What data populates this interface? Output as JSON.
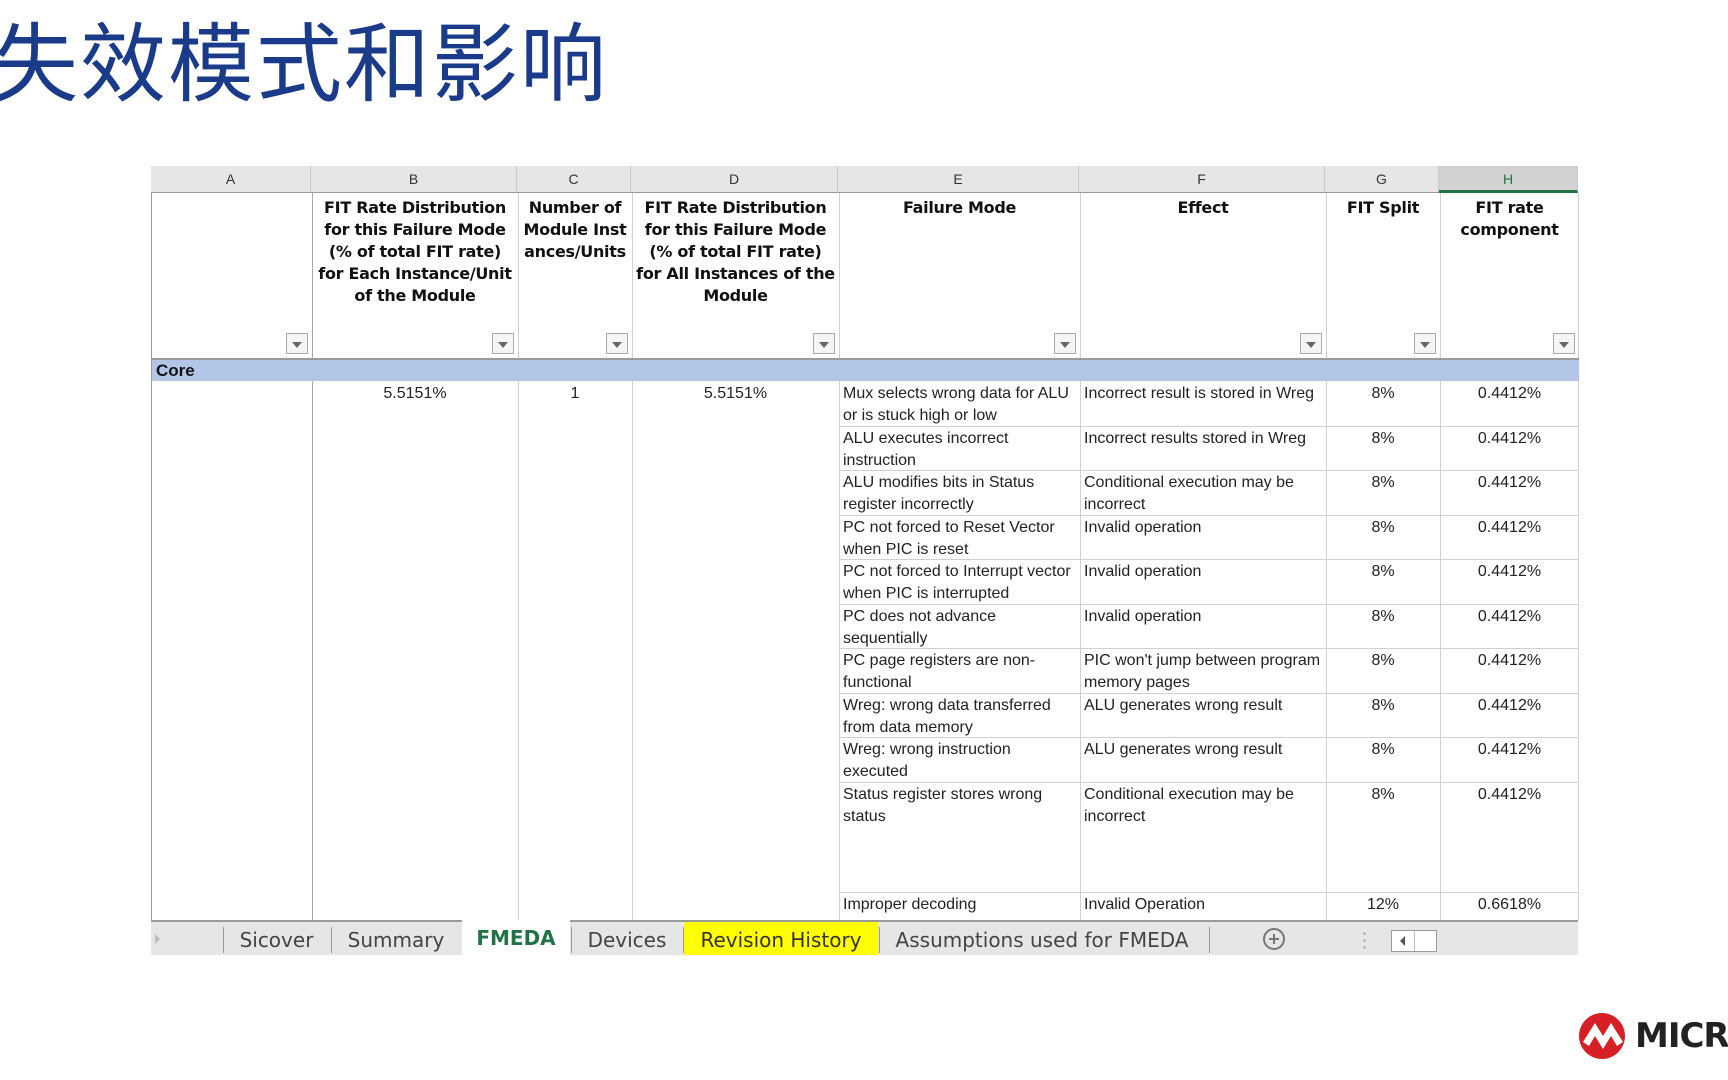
{
  "slide": {
    "title": "失效模式和影响",
    "logo_text": "MICRO",
    "brand_color": "#d71f26",
    "title_color": "#1a3a8a"
  },
  "sheet": {
    "column_letters": [
      "A",
      "B",
      "C",
      "D",
      "E",
      "F",
      "G",
      "H"
    ],
    "selected_column": "H",
    "headers": {
      "A": "",
      "B": "FIT Rate Distribution for this Failure Mode (% of total FIT rate) for Each Instance/Unit of the Module",
      "C": "Number of Module Instances/Units",
      "D": "FIT Rate Distribution for this Failure Mode (% of total FIT rate) for All Instances of the Module",
      "E": "Failure Mode",
      "F": "Effect",
      "G": "FIT Split",
      "H": "FIT rate component"
    },
    "group": {
      "label": "Core",
      "band_color": "#b4c6e7",
      "fit_each_instance": "5.5151%",
      "instances": "1",
      "fit_all_instances": "5.5151%"
    },
    "rows": [
      {
        "failure_mode": "Mux selects wrong data for ALU or is stuck high or low",
        "effect": "Incorrect result is stored in Wreg",
        "fit_split": "8%",
        "fit_component": "0.4412%"
      },
      {
        "failure_mode": "ALU executes incorrect instruction",
        "effect": "Incorrect results stored in Wreg",
        "fit_split": "8%",
        "fit_component": "0.4412%"
      },
      {
        "failure_mode": "ALU modifies bits in Status register incorrectly",
        "effect": "Conditional execution may be incorrect",
        "fit_split": "8%",
        "fit_component": "0.4412%"
      },
      {
        "failure_mode": "PC not forced to Reset Vector when PIC is reset",
        "effect": "Invalid operation",
        "fit_split": "8%",
        "fit_component": "0.4412%"
      },
      {
        "failure_mode": "PC not forced to Interrupt vector when PIC is interrupted",
        "effect": "Invalid operation",
        "fit_split": "8%",
        "fit_component": "0.4412%"
      },
      {
        "failure_mode": "PC does not advance sequentially",
        "effect": "Invalid operation",
        "fit_split": "8%",
        "fit_component": "0.4412%"
      },
      {
        "failure_mode": "PC page registers are non-functional",
        "effect": "PIC won't jump between program memory pages",
        "fit_split": "8%",
        "fit_component": "0.4412%"
      },
      {
        "failure_mode": "Wreg: wrong data transferred from data memory",
        "effect": "ALU generates wrong result",
        "fit_split": "8%",
        "fit_component": "0.4412%"
      },
      {
        "failure_mode": "Wreg: wrong instruction executed",
        "effect": "ALU generates wrong result",
        "fit_split": "8%",
        "fit_component": "0.4412%"
      },
      {
        "failure_mode": "Status register stores wrong status",
        "effect": "Conditional execution may be incorrect",
        "fit_split": "8%",
        "fit_component": "0.4412%"
      },
      {
        "failure_mode": "Improper decoding",
        "effect": "Invalid Operation",
        "fit_split": "12%",
        "fit_component": "0.6618%"
      }
    ]
  },
  "tabs": [
    {
      "label": "Sicover",
      "state": "normal"
    },
    {
      "label": "Summary",
      "state": "normal"
    },
    {
      "label": "FMEDA",
      "state": "active"
    },
    {
      "label": "Devices",
      "state": "normal"
    },
    {
      "label": "Revision History",
      "state": "highlighted"
    },
    {
      "label": "Assumptions used for FMEDA",
      "state": "normal"
    }
  ],
  "icons": {
    "add_sheet": "plus-circle-icon",
    "filter": "dropdown-arrow-icon",
    "scroll_left": "caret-left-icon"
  }
}
